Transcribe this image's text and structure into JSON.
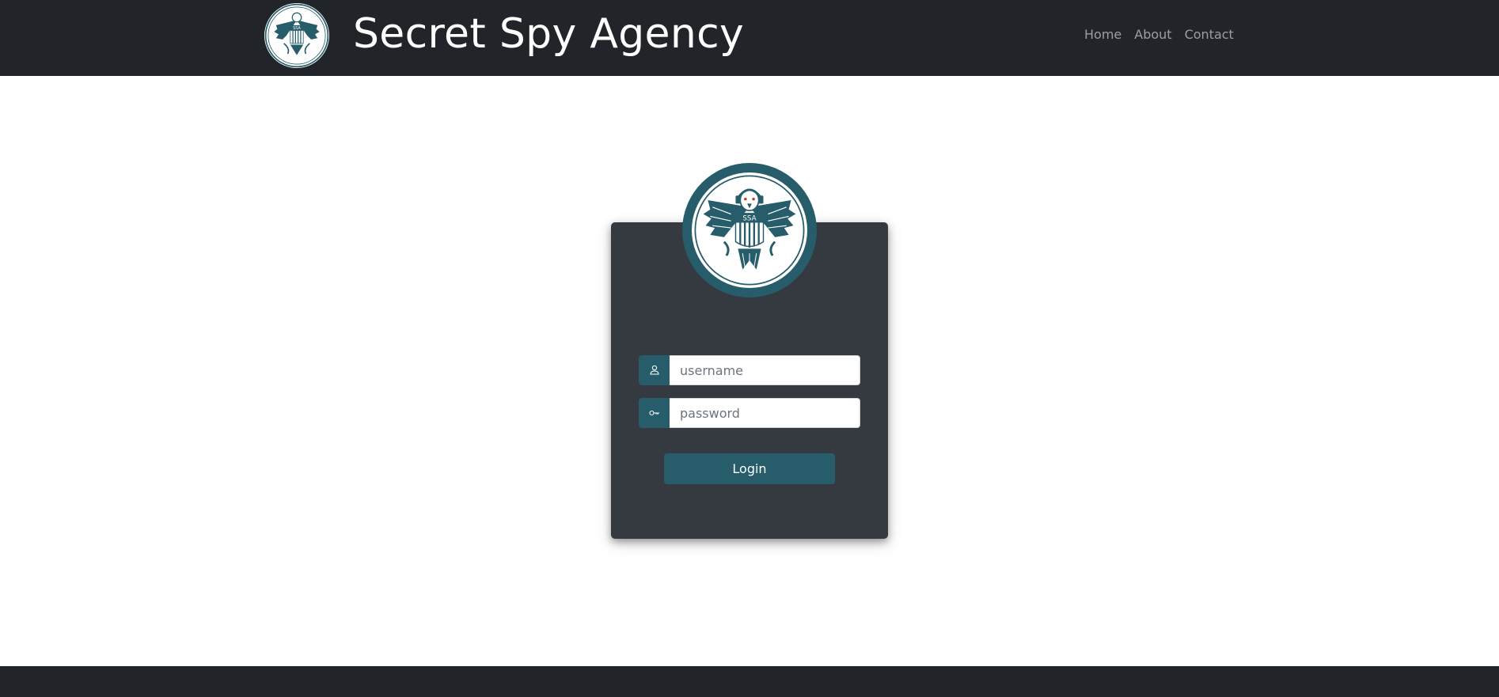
{
  "header": {
    "brand_title": "Secret Spy Agency",
    "logo_text": "SSA",
    "nav": [
      {
        "label": "Home"
      },
      {
        "label": "About"
      },
      {
        "label": "Contact"
      }
    ]
  },
  "login": {
    "seal_text": "SSA",
    "username": {
      "placeholder": "username",
      "value": "",
      "icon": "user-icon"
    },
    "password": {
      "placeholder": "password",
      "value": "",
      "icon": "key-icon"
    },
    "submit_label": "Login"
  },
  "colors": {
    "navbar": "#212529",
    "card": "#343a40",
    "accent": "#275d6b",
    "footer": "#212529"
  }
}
